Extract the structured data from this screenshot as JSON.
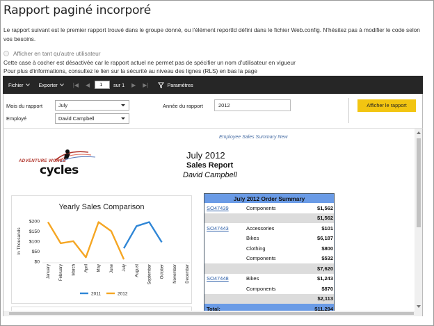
{
  "page": {
    "title": "Rapport paginé incorporé",
    "intro": "Le rapport suivant est le premier rapport trouvé dans le groupe donné, ou l'élément reportId défini dans le fichier Web.config. N'hésitez pas à modifier le code selon vos besoins.",
    "checkbox_label": "Afficher en tant qu'autre utilisateur",
    "note_disabled": "Cette case à cocher est désactivée car le rapport actuel ne permet pas de spécifier un nom d'utilisateur en vigueur",
    "note_rls": "Pour plus d'informations, consultez le lien sur la sécurité au niveau des lignes (RLS) en bas la page"
  },
  "toolbar": {
    "file": "Fichier",
    "export": "Exporter",
    "first": "|◀",
    "prev": "◀",
    "page_value": "1",
    "page_of": "sur 1",
    "next": "▶",
    "last": "▶|",
    "params": "Paramètres"
  },
  "parameters": {
    "month_label": "Mois du rapport",
    "month_value": "July",
    "employee_label": "Employé",
    "employee_value": "David Campbell",
    "year_label": "Année du rapport",
    "year_value": "2012",
    "show_button": "Afficher le rapport"
  },
  "report": {
    "top_link": "Employee Sales Summary New",
    "logo_line1": "ADVENTURE WORKS",
    "logo_line2": "cycles",
    "heading_month_year": "July  2012",
    "heading_title": "Sales Report",
    "heading_employee": "David Campbell",
    "summary_title": "July 2012 Order Summary",
    "total_label": "Total:",
    "total_value": "$11,294",
    "orders": [
      {
        "id": "SO47439",
        "items": [
          {
            "name": "Components",
            "amount": "$1,562"
          }
        ],
        "subtotal": "$1,562"
      },
      {
        "id": "SO47443",
        "items": [
          {
            "name": "Accessories",
            "amount": "$101"
          },
          {
            "name": "Bikes",
            "amount": "$6,187"
          },
          {
            "name": "Clothing",
            "amount": "$800"
          },
          {
            "name": "Components",
            "amount": "$532"
          }
        ],
        "subtotal": "$7,620"
      },
      {
        "id": "SO47448",
        "items": [
          {
            "name": "Bikes",
            "amount": "$1,243"
          },
          {
            "name": "Components",
            "amount": "$870"
          }
        ],
        "subtotal": "$2,113"
      }
    ]
  },
  "chart_data": {
    "type": "line",
    "title": "Yearly Sales Comparison",
    "ylabel": "In Thousands",
    "xlabel": "",
    "categories": [
      "January",
      "February",
      "March",
      "April",
      "May",
      "June",
      "July",
      "August",
      "September",
      "October",
      "November",
      "December"
    ],
    "yticks": [
      "$200",
      "$150",
      "$100",
      "$50",
      "$0"
    ],
    "ylim": [
      0,
      200
    ],
    "grid": false,
    "legend_position": "bottom",
    "series": [
      {
        "name": "2011",
        "color": "#2f86d6",
        "values": [
          null,
          null,
          null,
          null,
          null,
          null,
          65,
          175,
          195,
          95,
          null,
          null
        ]
      },
      {
        "name": "2012",
        "color": "#f5a623",
        "values": [
          195,
          90,
          100,
          20,
          195,
          150,
          10,
          null,
          null,
          null,
          null,
          null
        ]
      }
    ]
  }
}
